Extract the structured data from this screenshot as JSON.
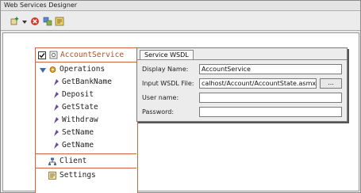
{
  "window": {
    "title": "Web Services Designer"
  },
  "toolbar": {
    "items": [
      {
        "name": "add-service",
        "icon": "add-service-icon"
      },
      {
        "name": "dropdown",
        "icon": "chevron-down-icon"
      },
      {
        "name": "delete",
        "icon": "delete-icon"
      },
      {
        "name": "refresh",
        "icon": "refresh-icon"
      },
      {
        "name": "save",
        "icon": "save-icon"
      }
    ]
  },
  "tree": {
    "service": {
      "label": "AccountService",
      "checked": true,
      "icon": "service-icon"
    },
    "operations": {
      "label": "Operations",
      "icon": "operations-icon",
      "items": [
        "GetBankName",
        "Deposit",
        "GetState",
        "Withdraw",
        "SetName",
        "GetName"
      ]
    },
    "client": {
      "label": "Client",
      "icon": "client-icon"
    },
    "settings": {
      "label": "Settings",
      "icon": "settings-icon"
    }
  },
  "props": {
    "tab": "Service WSDL",
    "display_name_label": "Display Name:",
    "display_name_value": "AccountService",
    "wsdl_label": "Input WSDL File:",
    "wsdl_value": "calhost/Account/AccountState.asmx?WSDL",
    "browse_label": "...",
    "user_label": "User name:",
    "user_value": "",
    "password_label": "Password:",
    "password_value": ""
  },
  "colors": {
    "accent": "#d2633c",
    "service_text": "#c24a1e"
  }
}
